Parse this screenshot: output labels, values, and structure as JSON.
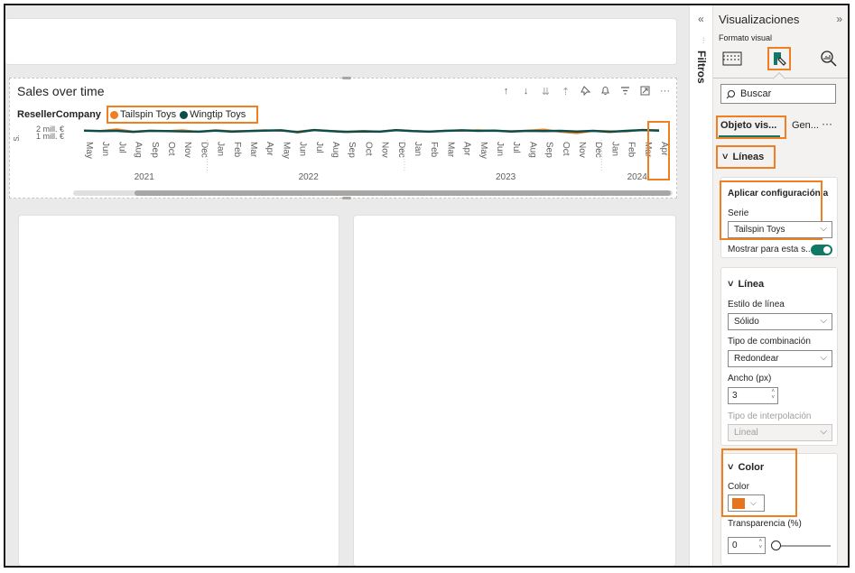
{
  "chart": {
    "title": "Sales over time",
    "legend_title": "ResellerCompany",
    "legend_items": [
      {
        "label": "Tailspin Toys",
        "color": "#f07f22"
      },
      {
        "label": "Wingtip Toys",
        "color": "#0e4d4a"
      }
    ],
    "y_ticks": [
      "2 mill. €",
      "1 mill. €"
    ],
    "y_axis_label_abbrev": "S.",
    "header_icons": [
      "arrow-up-icon",
      "arrow-down-icon",
      "double-arrow-down-icon",
      "drill-up-icon",
      "pin-icon",
      "notification-icon",
      "filter-icon",
      "focus-mode-icon",
      "more-options-icon"
    ]
  },
  "chart_data": {
    "type": "line",
    "x": [
      "May",
      "Jun",
      "Jul",
      "Aug",
      "Sep",
      "Oct",
      "Nov",
      "Dec",
      "Jan",
      "Feb",
      "Mar",
      "Apr",
      "May",
      "Jun",
      "Jul",
      "Aug",
      "Sep",
      "Oct",
      "Nov",
      "Dec",
      "Jan",
      "Feb",
      "Mar",
      "Apr",
      "May",
      "Jun",
      "Jul",
      "Aug",
      "Sep",
      "Oct",
      "Nov",
      "Dec",
      "Jan",
      "Feb",
      "Mar",
      "Apr"
    ],
    "years": [
      {
        "label": "2021",
        "start": 0,
        "end": 7
      },
      {
        "label": "2022",
        "start": 8,
        "end": 19
      },
      {
        "label": "2023",
        "start": 20,
        "end": 31
      },
      {
        "label": "2024",
        "start": 32,
        "end": 35
      }
    ],
    "ylim": [
      0,
      3
    ],
    "series": [
      {
        "name": "Tailspin Toys",
        "color": "#f07f22",
        "values": [
          1.5,
          1.5,
          1.62,
          1.45,
          1.52,
          1.48,
          1.55,
          1.42,
          1.55,
          1.48,
          1.5,
          1.55,
          1.5,
          1.45,
          1.58,
          1.5,
          1.45,
          1.5,
          1.45,
          1.58,
          1.5,
          1.45,
          1.52,
          1.5,
          1.55,
          1.5,
          1.48,
          1.52,
          1.6,
          1.42,
          1.32,
          1.5,
          1.48,
          1.45,
          1.58,
          1.55
        ]
      },
      {
        "name": "Wingtip Toys",
        "color": "#0e4d4a",
        "values": [
          1.52,
          1.48,
          1.5,
          1.42,
          1.5,
          1.48,
          1.46,
          1.44,
          1.52,
          1.44,
          1.48,
          1.52,
          1.54,
          1.4,
          1.56,
          1.48,
          1.42,
          1.46,
          1.44,
          1.55,
          1.48,
          1.44,
          1.5,
          1.54,
          1.5,
          1.52,
          1.45,
          1.5,
          1.48,
          1.5,
          1.45,
          1.5,
          1.42,
          1.5,
          1.56,
          1.52
        ]
      }
    ]
  },
  "filters": {
    "label": "Filtros",
    "collapse_icon": "chevron-left-icon"
  },
  "pane": {
    "title": "Visualizaciones",
    "subtitle": "Formato visual",
    "search_placeholder": "Buscar",
    "tab_visual": "Objeto vis...",
    "tab_general": "Gen...",
    "tab_more": "···",
    "section_lines": "Líneas",
    "apply_settings_label": "Aplicar configuración a",
    "series_label": "Serie",
    "series_value": "Tailspin Toys",
    "show_for_label": "Mostrar para esta s...",
    "section_line": "Línea",
    "line_style_label": "Estilo de línea",
    "line_style_value": "Sólido",
    "join_type_label": "Tipo de combinación",
    "join_type_value": "Redondear",
    "width_label": "Ancho (px)",
    "width_value": "3",
    "interpolation_label": "Tipo de interpolación",
    "interpolation_value": "Lineal",
    "section_color": "Color",
    "color_label": "Color",
    "color_value": "#e8731f",
    "transparency_label": "Transparencia (%)",
    "transparency_value": "0"
  }
}
